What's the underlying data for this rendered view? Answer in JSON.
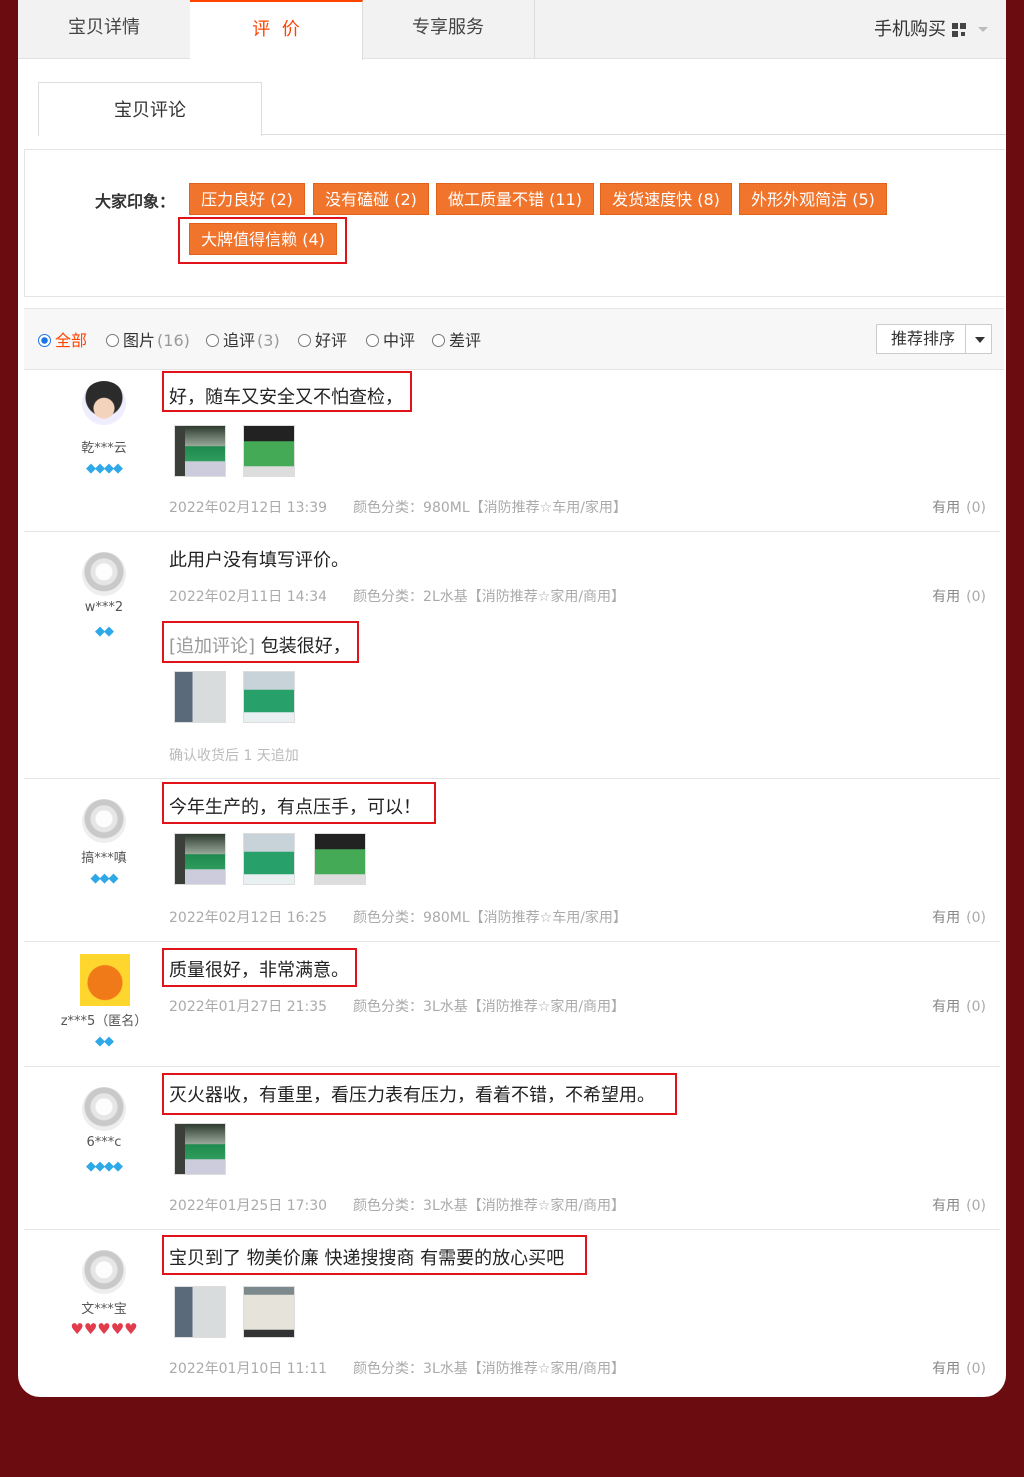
{
  "tabs": [
    {
      "label": "宝贝详情",
      "active": false
    },
    {
      "label": "评  价",
      "active": true
    },
    {
      "label": "专享服务",
      "active": false
    }
  ],
  "mobile_buy": "手机购买",
  "sub_tab": "宝贝评论",
  "impressions": {
    "label": "大家印象：",
    "tags": [
      "压力良好 (2)",
      "没有磕碰 (2)",
      "做工质量不错 (11)",
      "发货速度快 (8)",
      "外形外观简洁 (5)",
      "大牌值得信赖 (4)"
    ]
  },
  "filters": [
    {
      "label": "全部",
      "count": "",
      "selected": true
    },
    {
      "label": "图片",
      "count": "(16)",
      "selected": false
    },
    {
      "label": "追评",
      "count": "(3)",
      "selected": false
    },
    {
      "label": "好评",
      "count": "",
      "selected": false
    },
    {
      "label": "中评",
      "count": "",
      "selected": false
    },
    {
      "label": "差评",
      "count": "",
      "selected": false
    }
  ],
  "sort_label": "推荐排序",
  "reviews": [
    {
      "user": "乾***云",
      "rank": "◆◆◆◆",
      "text": "好，随车又安全又不怕查检，",
      "date": "2022年02月12日 13:39",
      "sku": "颜色分类：980ML【消防推荐☆车用/家用】",
      "useful": "有用",
      "useful_count": "(0)"
    },
    {
      "user": "w***2",
      "rank": "◆◆",
      "text": "此用户没有填写评价。",
      "date": "2022年02月11日 14:34",
      "sku": "颜色分类：2L水基【消防推荐☆家用/商用】",
      "useful": "有用",
      "useful_count": "(0)",
      "followup_tag": "[追加评论]",
      "followup_text": "包装很好，",
      "followup_note": "确认收货后 1 天追加"
    },
    {
      "user": "搞***嗔",
      "rank": "◆◆◆",
      "text": "今年生产的，有点压手，可以！",
      "date": "2022年02月12日 16:25",
      "sku": "颜色分类：980ML【消防推荐☆车用/家用】",
      "useful": "有用",
      "useful_count": "(0)"
    },
    {
      "user": "z***5（匿名）",
      "rank": "◆◆",
      "text": "质量很好，非常满意。",
      "date": "2022年01月27日 21:35",
      "sku": "颜色分类：3L水基【消防推荐☆家用/商用】",
      "useful": "有用",
      "useful_count": "(0)"
    },
    {
      "user": "6***c",
      "rank": "◆◆◆◆",
      "text": "灭火器收，有重里，看压力表有压力，看着不错，不希望用。",
      "date": "2022年01月25日 17:30",
      "sku": "颜色分类：3L水基【消防推荐☆家用/商用】",
      "useful": "有用",
      "useful_count": "(0)"
    },
    {
      "user": "文***宝",
      "rank": "♥♥♥♥♥",
      "text": "宝贝到了 物美价廉 快递搜搜商 有需要的放心买吧",
      "date": "2022年01月10日 11:11",
      "sku": "颜色分类：3L水基【消防推荐☆家用/商用】",
      "useful": "有用",
      "useful_count": "(0)"
    }
  ],
  "colors": {
    "accent": "#ff4400",
    "tag_bg": "#f0742c",
    "highlight_border": "#e0121a",
    "page_bg": "#6b0d10",
    "gem": "#2fa8e8"
  }
}
